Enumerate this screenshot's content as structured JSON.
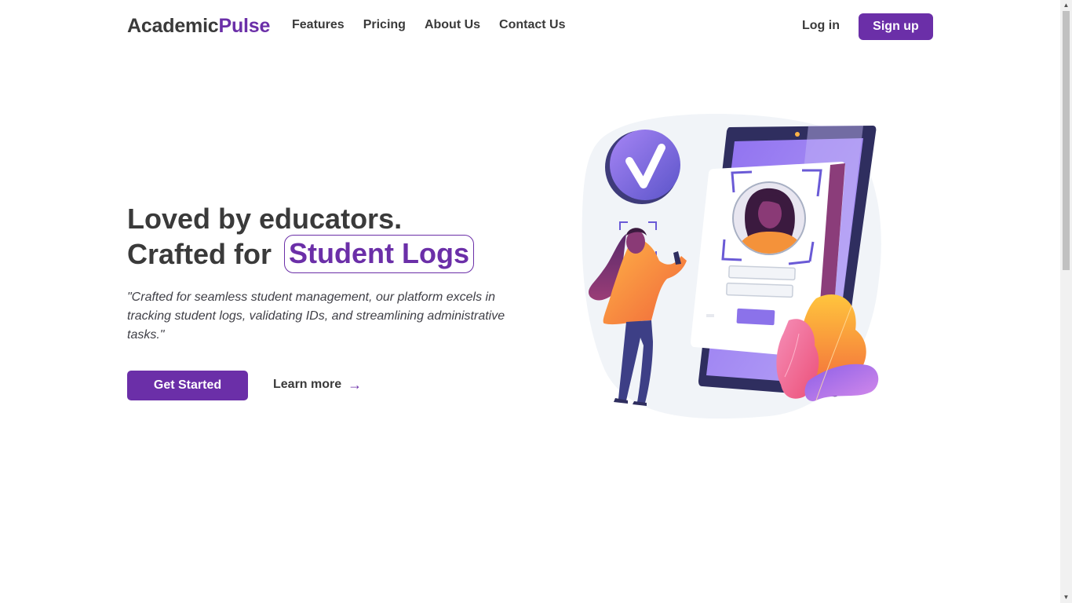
{
  "header": {
    "logo": {
      "part1": "Academic",
      "part2": "Pulse"
    },
    "nav": [
      "Features",
      "Pricing",
      "About Us",
      "Contact Us"
    ],
    "login_label": "Log in",
    "signup_label": "Sign up"
  },
  "hero": {
    "headline_line1": "Loved by educators.",
    "headline_line2": "Crafted for",
    "headline_highlight": "Student Logs",
    "quote": "\"Crafted for seamless student management, our platform excels in tracking student logs, validating IDs, and streamlining administrative tasks.\"",
    "cta_primary": "Get Started",
    "cta_secondary": "Learn more",
    "cta_secondary_icon": "arrow-right-icon"
  },
  "colors": {
    "brand": "#6b2fa8",
    "text": "#3a3a3a"
  }
}
